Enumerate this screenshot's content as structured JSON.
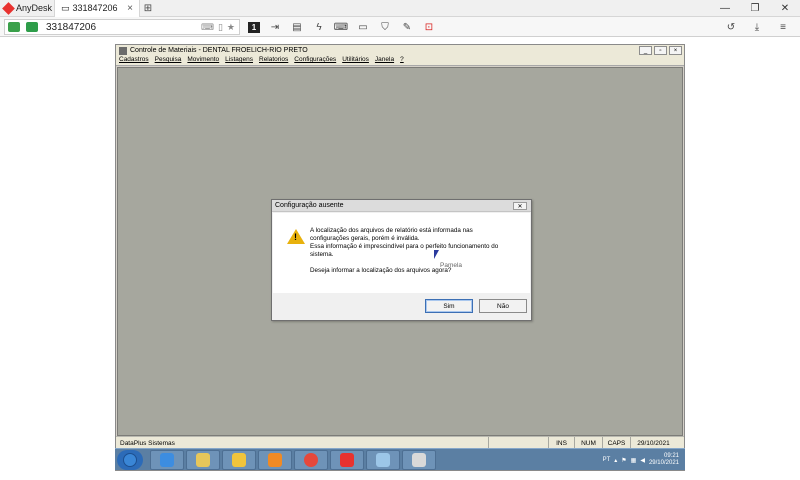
{
  "anydesk": {
    "app_name": "AnyDesk",
    "tab_title": "331847206",
    "address_value": "331847206"
  },
  "app": {
    "title": "Controle de Materiais - DENTAL FROELICH-RIO PRETO",
    "menu": [
      "Cadastros",
      "Pesquisa",
      "Movimento",
      "Listagens",
      "Relatorios",
      "Configurações",
      "Utilitários",
      "Janela",
      "?"
    ],
    "status": {
      "company": "DataPlus Sistemas",
      "ins": "INS",
      "num": "NUM",
      "caps": "CAPS",
      "date": "29/10/2021"
    }
  },
  "dialog": {
    "title": "Configuração ausente",
    "line1": "A localização dos arquivos de relatório está informada nas",
    "line2": "configurações gerais, porém é inválida.",
    "line3": "Essa informação é imprescindível para o perfeito funcionamento do",
    "line4": "sistema.",
    "question": "Deseja informar a localização dos arquivos agora?",
    "yes_label": "Sim",
    "no_label": "Não"
  },
  "cursor_label": "Pamela",
  "taskbar": {
    "lang": "PT",
    "time": "09:21",
    "date": "29/10/2021"
  },
  "colors": {
    "anydesk_red": "#e8322f",
    "app_client_bg": "#a6a79e",
    "warning_yellow": "#e8b10d"
  }
}
